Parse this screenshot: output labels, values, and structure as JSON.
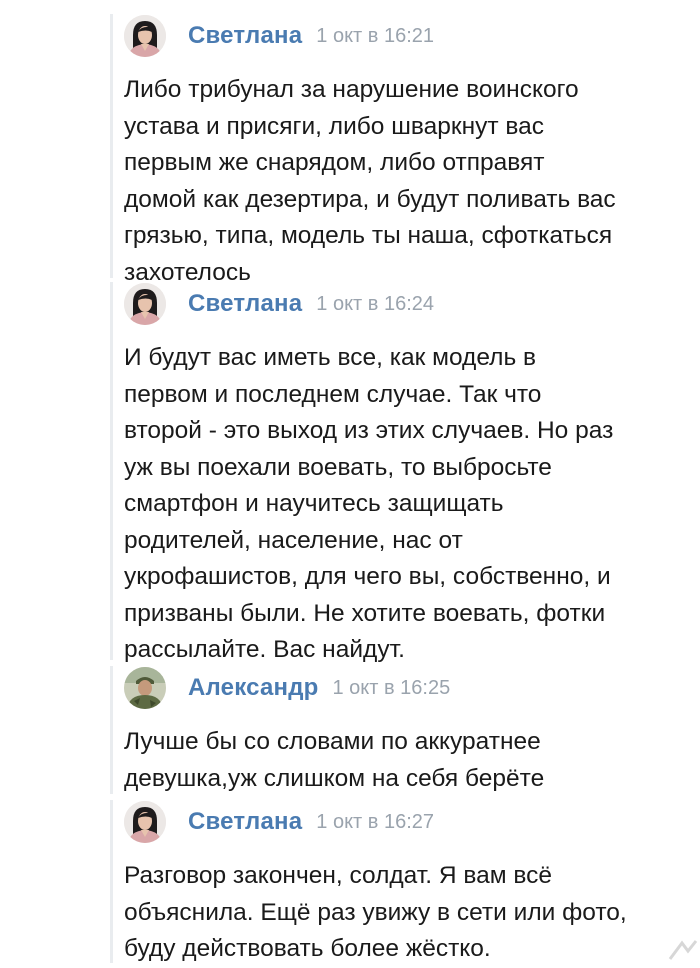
{
  "comments": [
    {
      "author": "Светлана",
      "time": "1 окт в 16:21",
      "avatar": "woman-avatar",
      "lines": [
        "Либо трибунал за нарушение воинского",
        "устава и присяги, либо шваркнут вас",
        "первым же снарядом, либо отправят",
        "домой как дезертира, и будут поливать вас",
        "грязью, типа, модель ты наша, сфоткаться",
        "захотелось"
      ]
    },
    {
      "author": "Светлана",
      "time": "1 окт в 16:24",
      "avatar": "woman-avatar",
      "lines": [
        "И будут вас иметь все, как модель в",
        "первом и последнем случае. Так что",
        "второй - это выход из этих случаев. Но раз",
        "уж вы поехали воевать, то выбросьте",
        "смартфон и научитесь защищать",
        "родителей, население, нас от",
        "укрофашистов, для чего вы, собственно, и",
        "призваны были. Не хотите воевать, фотки",
        "рассылайте. Вас найдут."
      ]
    },
    {
      "author": "Александр",
      "time": "1 окт в 16:25",
      "avatar": "soldier-avatar",
      "lines": [
        "Лучше бы со словами по аккуратнее",
        "девушка,уж слишком на себя берёте"
      ]
    },
    {
      "author": "Светлана",
      "time": "1 окт в 16:27",
      "avatar": "woman-avatar",
      "lines": [
        "Разговор закончен, солдат. Я вам всё",
        "объяснила. Ещё раз увижу в сети или фото,",
        "буду действовать более жёстко."
      ]
    }
  ],
  "colors": {
    "author": "#4a7bb1",
    "time": "#9aa3ad",
    "text": "#1a1a1a",
    "rail": "#e9ecef"
  }
}
